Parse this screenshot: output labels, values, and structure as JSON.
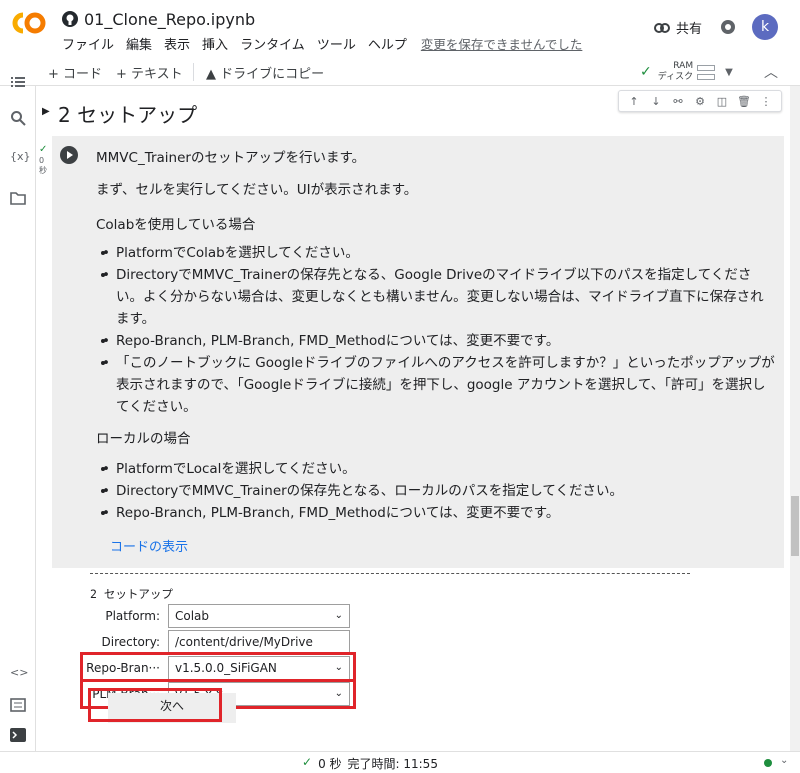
{
  "app": {
    "title": "01_Clone_Repo.ipynb",
    "menu": [
      "ファイル",
      "編集",
      "表示",
      "挿入",
      "ランタイム",
      "ツール",
      "ヘルプ"
    ],
    "unsaved_notice": "変更を保存できませんでした",
    "share_label": "共有",
    "avatar_letter": "k",
    "brand_colors": {
      "orange": "#f9ab00",
      "accent": "#1a73e8",
      "highlight": "#e0242a"
    }
  },
  "toolbar": {
    "add_code": "+ コード",
    "add_text": "+ テキスト",
    "copy_drive": "ドライブにコピー",
    "ram_label": "RAM",
    "disk_label": "ディスク"
  },
  "section": {
    "title": "2 セットアップ",
    "exec_time_value": "0",
    "exec_time_unit": "秒"
  },
  "markdown": {
    "p1": "MMVC_Trainerのセットアップを行います。",
    "p2": "まず、セルを実行してください。UIが表示されます。",
    "colab_heading": "Colabを使用している場合",
    "colab_items": [
      "PlatformでColabを選択してください。",
      "DirectoryでMMVC_Trainerの保存先となる、Google Driveのマイドライブ以下のパスを指定してください。よく分からない場合は、変更しなくとも構いません。変更しない場合は、マイドライブ直下に保存されます。",
      "Repo-Branch, PLM-Branch, FMD_Methodについては、変更不要です。",
      "「このノートブックに Googleドライブのファイルへのアクセスを許可しますか？」といったポップアップが表示されますので、「Googleドライブに接続」を押下し、google アカウントを選択して、「許可」を選択してください。"
    ],
    "local_heading": "ローカルの場合",
    "local_items": [
      "PlatformでLocalを選択してください。",
      "DirectoryでMMVC_Trainerの保存先となる、ローカルのパスを指定してください。",
      "Repo-Branch, PLM-Branch, FMD_Methodについては、変更不要です。"
    ],
    "show_code": "コードの表示"
  },
  "output": {
    "dashes": "----------------------------------------------------------------------------------------",
    "title": "2 セットアップ",
    "platform_label": "Platform:",
    "platform_value": "Colab",
    "directory_label": "Directory:",
    "directory_value": "/content/drive/MyDrive",
    "repo_label": "Repo-Bran···",
    "repo_value": "v1.5.0.0_SiFiGAN",
    "plm_label": "PLM-Bran···",
    "plm_value": "v1.5.x.x",
    "next_label": "次へ"
  },
  "status": {
    "check": "✓",
    "time": "0 秒",
    "completed": "完了時間: 11:55"
  }
}
